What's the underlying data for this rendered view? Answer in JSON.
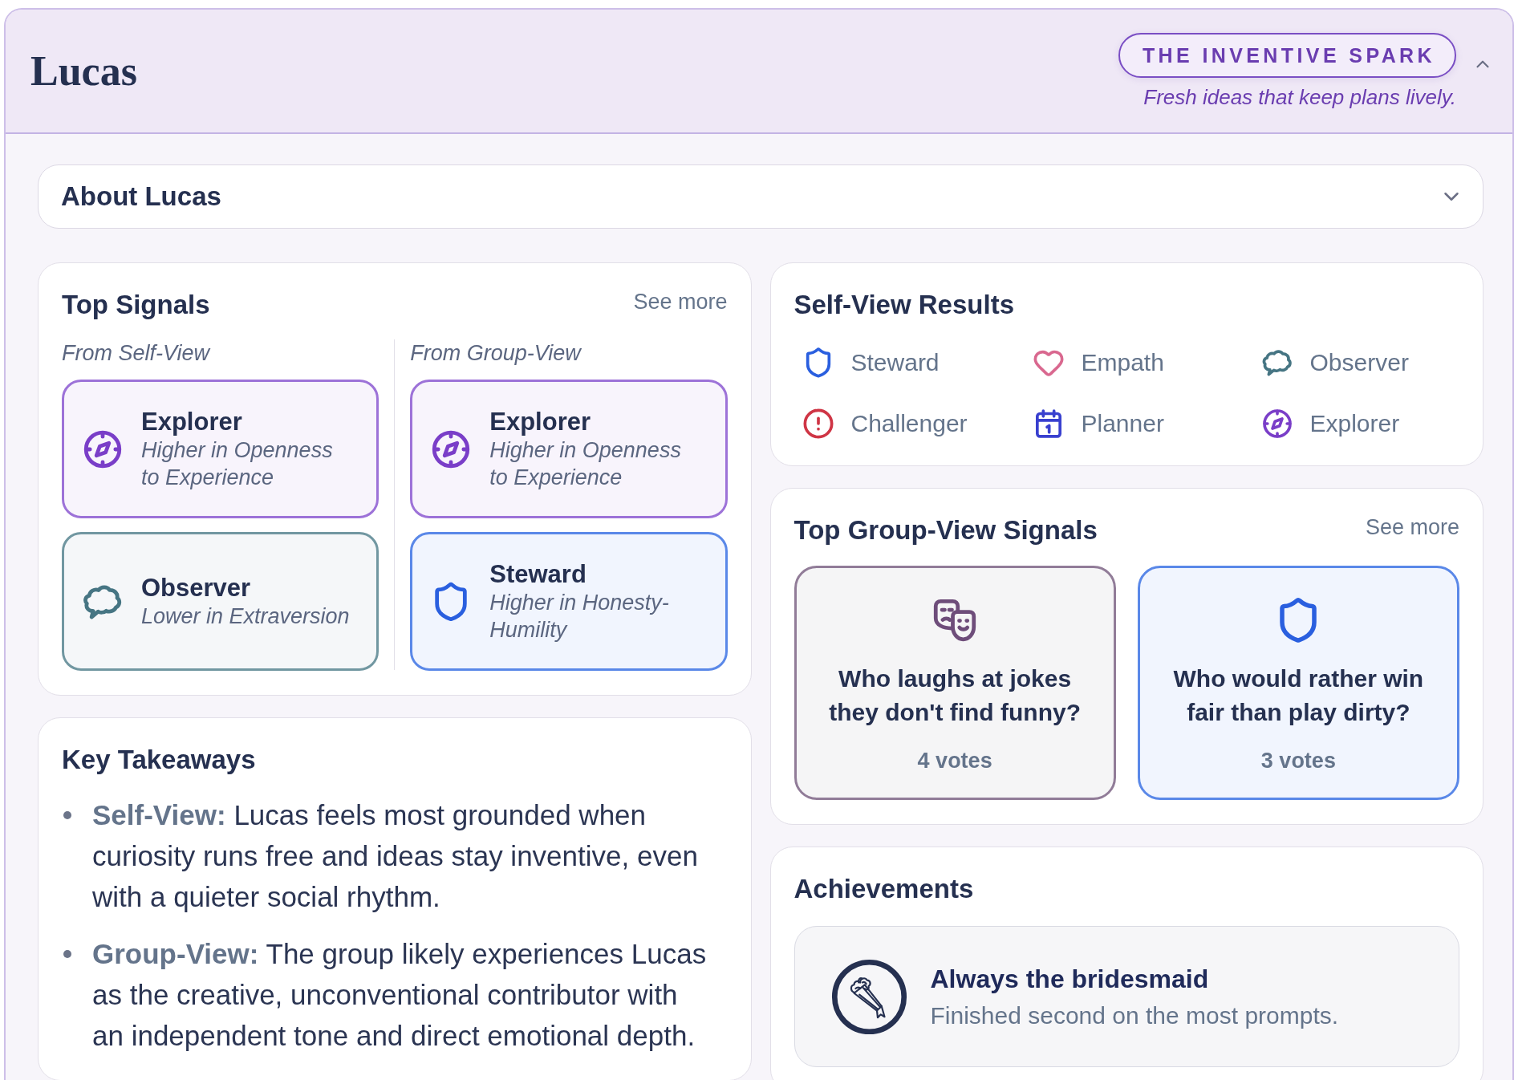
{
  "header": {
    "name": "Lucas",
    "badge": "THE INVENTIVE SPARK",
    "tagline": "Fresh ideas that keep plans lively.",
    "expanded": true
  },
  "about": {
    "title": "About Lucas",
    "expanded": false
  },
  "top_signals": {
    "title": "Top Signals",
    "link": "See more",
    "columns": [
      {
        "heading": "From Self-View",
        "signals": [
          {
            "kind": "explorer",
            "title": "Explorer",
            "detail": "Higher in Openness to Experience"
          },
          {
            "kind": "observer",
            "title": "Observer",
            "detail": "Lower in Extraversion"
          }
        ]
      },
      {
        "heading": "From Group-View",
        "signals": [
          {
            "kind": "explorer",
            "title": "Explorer",
            "detail": "Higher in Openness to Experience"
          },
          {
            "kind": "steward",
            "title": "Steward",
            "detail": "Higher in Honesty-Humility"
          }
        ]
      }
    ]
  },
  "self_view_results": {
    "title": "Self-View Results",
    "items": [
      {
        "kind": "steward",
        "label": "Steward"
      },
      {
        "kind": "empath",
        "label": "Empath"
      },
      {
        "kind": "observer",
        "label": "Observer"
      },
      {
        "kind": "challenger",
        "label": "Challenger"
      },
      {
        "kind": "planner",
        "label": "Planner"
      },
      {
        "kind": "explorer",
        "label": "Explorer"
      }
    ]
  },
  "group_view_signals": {
    "title": "Top Group-View Signals",
    "link": "See more",
    "cards": [
      {
        "kind": "masks",
        "question": "Who laughs at jokes they don't find funny?",
        "votes": "4 votes"
      },
      {
        "kind": "steward",
        "question": "Who would rather win fair than play dirty?",
        "votes": "3 votes"
      }
    ]
  },
  "key_takeaways": {
    "title": "Key Takeaways",
    "items": [
      {
        "label": "Self-View:",
        "text": "Lucas feels most grounded when curiosity runs free and ideas stay inventive, even with a quieter social rhythm."
      },
      {
        "label": "Group-View:",
        "text": "The group likely experiences Lucas as the creative, unconventional contributor with an independent tone and direct emotional depth."
      }
    ]
  },
  "achievements": {
    "title": "Achievements",
    "items": [
      {
        "kind": "bouquet",
        "title": "Always the bridesmaid",
        "detail": "Finished second on the most prompts."
      }
    ]
  }
}
